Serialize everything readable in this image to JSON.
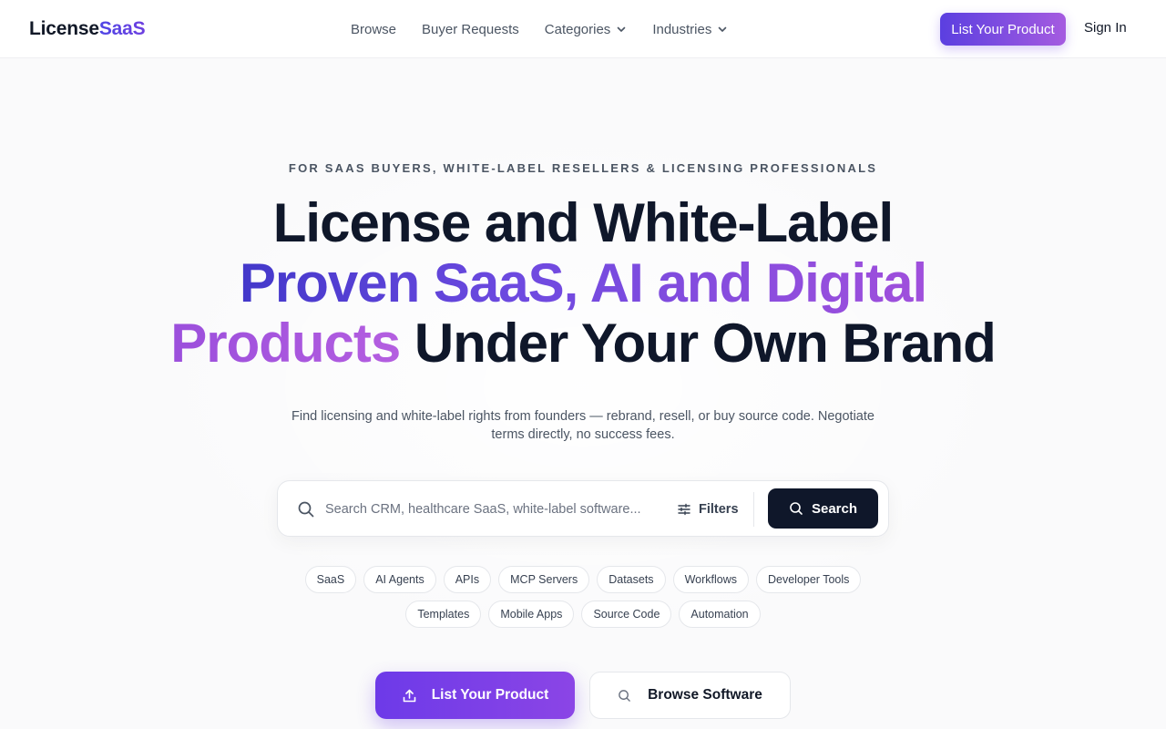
{
  "brand": {
    "name_part1": "License",
    "name_part2": "SaaS"
  },
  "nav": {
    "items": [
      {
        "label": "Browse",
        "has_dropdown": false
      },
      {
        "label": "Buyer Requests",
        "has_dropdown": false
      },
      {
        "label": "Categories",
        "has_dropdown": true
      },
      {
        "label": "Industries",
        "has_dropdown": true
      }
    ],
    "list_product_label": "List Your Product",
    "sign_in_label": "Sign In"
  },
  "hero": {
    "eyebrow": "FOR SAAS BUYERS, WHITE-LABEL RESELLERS & LICENSING PROFESSIONALS",
    "headline_line1": "License and White-Label",
    "headline_line2_gradient": "Proven SaaS, AI and Digital",
    "headline_line3_gradient": "Products",
    "headline_line3_rest": " Under Your Own Brand",
    "subtext": "Find licensing and white-label rights from founders — rebrand, resell, or buy source code. Negotiate terms directly, no success fees."
  },
  "search": {
    "placeholder": "Search CRM, healthcare SaaS, white-label software...",
    "value": "",
    "filters_label": "Filters",
    "button_label": "Search"
  },
  "chips": {
    "row1": [
      "SaaS",
      "AI Agents",
      "APIs",
      "MCP Servers",
      "Datasets",
      "Workflows",
      "Developer Tools"
    ],
    "row2": [
      "Templates",
      "Mobile Apps",
      "Source Code",
      "Automation"
    ]
  },
  "cta": {
    "primary_label": "List Your Product",
    "secondary_label": "Browse Software"
  },
  "colors": {
    "accent_start": "#5b3fe0",
    "accent_end": "#a55be0",
    "dark": "#0f172a",
    "background": "#fafafb"
  }
}
